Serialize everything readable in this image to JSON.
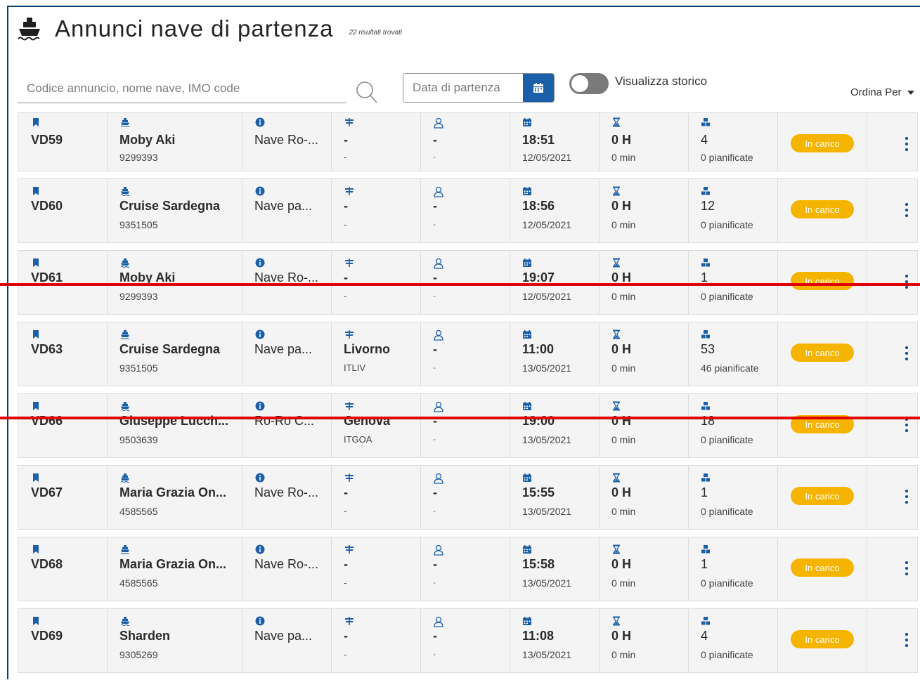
{
  "header": {
    "title": "Annunci nave di partenza",
    "results": "22 risultati trovati"
  },
  "controls": {
    "search_placeholder": "Codice annuncio, nome nave, IMO code",
    "date_placeholder": "Data di partenza",
    "toggle_label": "Visualizza storico",
    "toggle_on": false,
    "sort_label": "Ordina Per"
  },
  "colors": {
    "accent": "#1b5fa8",
    "badge": "#f5b400",
    "frame": "#0d3f72",
    "redline": "#e00000"
  },
  "rows": [
    {
      "code": "VD59",
      "ship": "Moby Aki",
      "imo": "9299393",
      "type": "Nave Ro-...",
      "port": "-",
      "port_code": "-",
      "agent": "-",
      "agent_sub": "-",
      "time": "18:51",
      "date": "12/05/2021",
      "dur_h": "0 H",
      "dur_m": "0 min",
      "count": "4",
      "planned": "0 pianificate",
      "status": "In carico"
    },
    {
      "code": "VD60",
      "ship": "Cruise Sardegna",
      "imo": "9351505",
      "type": "Nave pa...",
      "port": "-",
      "port_code": "-",
      "agent": "-",
      "agent_sub": "-",
      "time": "18:56",
      "date": "12/05/2021",
      "dur_h": "0 H",
      "dur_m": "0 min",
      "count": "12",
      "planned": "0 pianificate",
      "status": "In carico"
    },
    {
      "code": "VD61",
      "ship": "Moby Aki",
      "imo": "9299393",
      "type": "Nave Ro-...",
      "port": "-",
      "port_code": "-",
      "agent": "-",
      "agent_sub": "-",
      "time": "19:07",
      "date": "12/05/2021",
      "dur_h": "0 H",
      "dur_m": "0 min",
      "count": "1",
      "planned": "0 pianificate",
      "status": "In carico"
    },
    {
      "code": "VD63",
      "ship": "Cruise Sardegna",
      "imo": "9351505",
      "type": "Nave pa...",
      "port": "Livorno",
      "port_code": "ITLIV",
      "agent": "-",
      "agent_sub": "-",
      "time": "11:00",
      "date": "13/05/2021",
      "dur_h": "0 H",
      "dur_m": "0 min",
      "count": "53",
      "planned": "46 pianificate",
      "status": "In carico"
    },
    {
      "code": "VD66",
      "ship": "Giuseppe Lucch...",
      "imo": "9503639",
      "type": "Ro-Ro C...",
      "port": "Genova",
      "port_code": "ITGOA",
      "agent": "-",
      "agent_sub": "-",
      "time": "19:00",
      "date": "13/05/2021",
      "dur_h": "0 H",
      "dur_m": "0 min",
      "count": "18",
      "planned": "0 pianificate",
      "status": "In carico"
    },
    {
      "code": "VD67",
      "ship": "Maria Grazia On...",
      "imo": "4585565",
      "type": "Nave Ro-...",
      "port": "-",
      "port_code": "-",
      "agent": "-",
      "agent_sub": "-",
      "time": "15:55",
      "date": "13/05/2021",
      "dur_h": "0 H",
      "dur_m": "0 min",
      "count": "1",
      "planned": "0 pianificate",
      "status": "In carico"
    },
    {
      "code": "VD68",
      "ship": "Maria Grazia On...",
      "imo": "4585565",
      "type": "Nave Ro-...",
      "port": "-",
      "port_code": "-",
      "agent": "-",
      "agent_sub": "-",
      "time": "15:58",
      "date": "13/05/2021",
      "dur_h": "0 H",
      "dur_m": "0 min",
      "count": "1",
      "planned": "0 pianificate",
      "status": "In carico"
    },
    {
      "code": "VD69",
      "ship": "Sharden",
      "imo": "9305269",
      "type": "Nave pa...",
      "port": "-",
      "port_code": "-",
      "agent": "-",
      "agent_sub": "-",
      "time": "11:08",
      "date": "13/05/2021",
      "dur_h": "0 H",
      "dur_m": "0 min",
      "count": "4",
      "planned": "0 pianificate",
      "status": "In carico"
    }
  ]
}
